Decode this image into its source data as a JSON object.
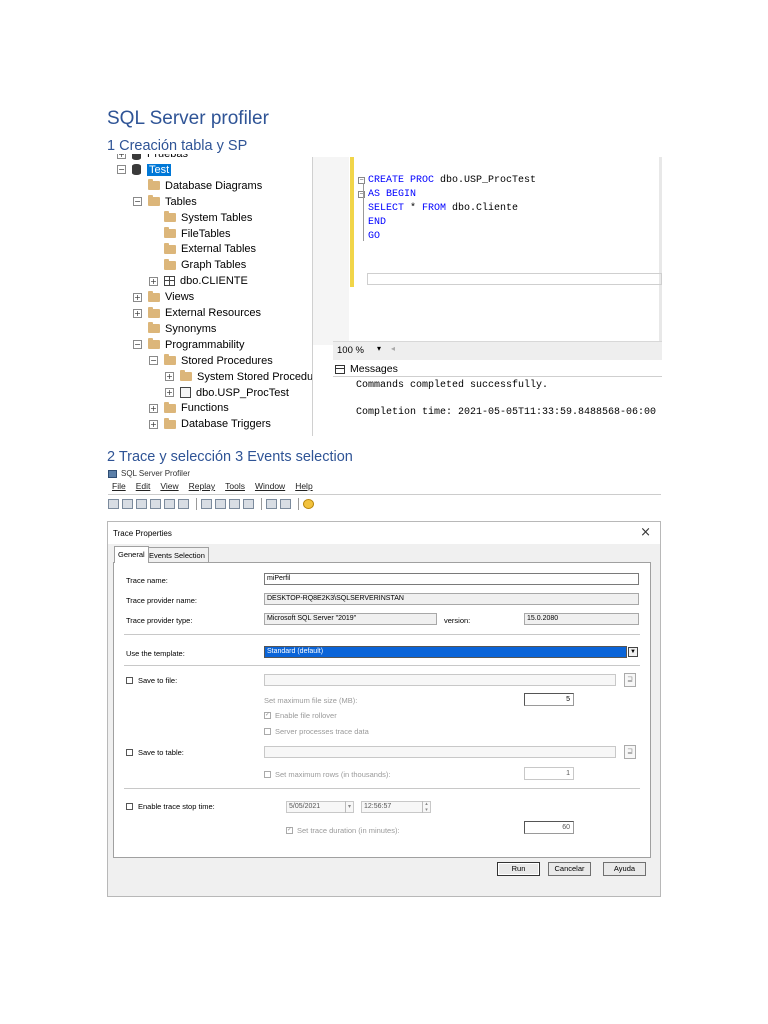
{
  "heading": "SQL Server profiler",
  "section1_title": "1 Creación tabla y SP",
  "section2_title": "2 Trace y selección 3 Events selection",
  "object_explorer": {
    "nodes": [
      {
        "label": "Pruebas",
        "expander": "+",
        "icon": "database-icon"
      },
      {
        "label": "Test",
        "expander": "−",
        "icon": "database-icon",
        "selected": true
      },
      {
        "label": "Database Diagrams",
        "expander": "",
        "icon": "folder-icon"
      },
      {
        "label": "Tables",
        "expander": "−",
        "icon": "folder-icon"
      },
      {
        "label": "System Tables",
        "expander": "",
        "icon": "folder-icon"
      },
      {
        "label": "FileTables",
        "expander": "",
        "icon": "folder-icon"
      },
      {
        "label": "External Tables",
        "expander": "",
        "icon": "folder-icon"
      },
      {
        "label": "Graph Tables",
        "expander": "",
        "icon": "folder-icon"
      },
      {
        "label": "dbo.CLIENTE",
        "expander": "+",
        "icon": "table-icon"
      },
      {
        "label": "Views",
        "expander": "+",
        "icon": "folder-icon"
      },
      {
        "label": "External Resources",
        "expander": "+",
        "icon": "folder-icon"
      },
      {
        "label": "Synonyms",
        "expander": "",
        "icon": "folder-icon"
      },
      {
        "label": "Programmability",
        "expander": "−",
        "icon": "folder-icon"
      },
      {
        "label": "Stored Procedures",
        "expander": "−",
        "icon": "folder-icon"
      },
      {
        "label": "System Stored Procedures",
        "expander": "+",
        "icon": "folder-icon"
      },
      {
        "label": "dbo.USP_ProcTest",
        "expander": "+",
        "icon": "stored-procedure-icon"
      },
      {
        "label": "Functions",
        "expander": "+",
        "icon": "folder-icon"
      },
      {
        "label": "Database Triggers",
        "expander": "+",
        "icon": "folder-icon"
      }
    ]
  },
  "query_editor": {
    "line1_kw": "CREATE PROC",
    "line1_rest": " dbo.USP_ProcTest",
    "line2_kw": "AS BEGIN",
    "line3_kw1": "SELECT",
    "line3_mid": " * ",
    "line3_kw2": "FROM",
    "line3_rest": " dbo.Cliente",
    "line4_kw": "END",
    "line5_kw": "GO",
    "zoom": "100 %",
    "messages_tab": "Messages",
    "message1": "Commands completed successfully.",
    "message2": "Completion time: 2021-05-05T11:33:59.8488568-06:00"
  },
  "profiler": {
    "app_title": "SQL Server Profiler",
    "menu": [
      "File",
      "Edit",
      "View",
      "Replay",
      "Tools",
      "Window",
      "Help"
    ],
    "dialog_title": "Trace Properties",
    "close_glyph": "×",
    "tabs": [
      "General",
      "Events Selection"
    ],
    "trace_name_label": "Trace name:",
    "trace_name_value": "miPerfil",
    "provider_name_label": "Trace provider name:",
    "provider_name_value": "DESKTOP-RQ8E2K3\\SQLSERVERINSTAN",
    "provider_type_label": "Trace provider type:",
    "provider_type_value": "Microsoft SQL Server \"2019\"",
    "version_label": "version:",
    "version_value": "15.0.2080",
    "template_label": "Use the template:",
    "template_value": "Standard (default)",
    "save_file_label": "Save to file:",
    "max_file_size_label": "Set maximum file size (MB):",
    "max_file_size_value": "5",
    "file_rollover_label": "Enable file rollover",
    "server_processes_label": "Server processes trace data",
    "save_table_label": "Save to table:",
    "max_rows_label": "Set maximum rows (in thousands):",
    "max_rows_value": "1",
    "stop_time_label": "Enable trace stop time:",
    "stop_date_value": "5/05/2021",
    "stop_clock_value": "12:56:57",
    "trace_duration_label": "Set trace duration (in minutes):",
    "trace_duration_value": "60",
    "run_button": "Run",
    "cancel_button": "Cancelar",
    "help_button": "Ayuda"
  }
}
